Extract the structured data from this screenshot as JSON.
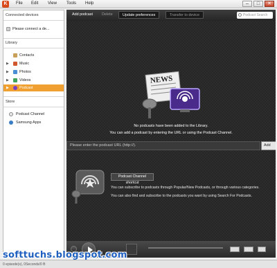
{
  "menubar": {
    "logo": "K",
    "items": [
      "File",
      "Edit",
      "View",
      "Tools",
      "Help"
    ]
  },
  "sidebar": {
    "connected_header": "Connected devices",
    "connect_prompt": "Please connect a de...",
    "library_header": "Library",
    "library_items": [
      {
        "label": "Contacts",
        "icon": "contacts-icon",
        "color": "#c9a058"
      },
      {
        "label": "Music",
        "icon": "music-icon",
        "color": "#d0582f"
      },
      {
        "label": "Photos",
        "icon": "photos-icon",
        "color": "#4a8fd6"
      },
      {
        "label": "Videos",
        "icon": "videos-icon",
        "color": "#3fa35a"
      },
      {
        "label": "Podcast",
        "icon": "podcast-icon",
        "color": "#7b3fc4"
      }
    ],
    "store_header": "Store",
    "store_items": [
      {
        "label": "Podcast Channel",
        "icon": "podcast-channel-icon"
      },
      {
        "label": "Samsung Apps",
        "icon": "samsung-apps-icon"
      }
    ],
    "selected_color": "#f0a030"
  },
  "toolbar": {
    "add_podcast": "Add podcast",
    "delete": "Delete",
    "update_preferences": "Update preferences",
    "transfer": "Transfer to device",
    "search_placeholder": "Podcast Search"
  },
  "content": {
    "empty_line1": "No podcasts have been added to the Library.",
    "empty_line2": "You can add a podcast by entering the URL or using the Podcast Channel.",
    "url_placeholder": "Please enter the podcast URL (http://).",
    "add_button": "Add",
    "news_text": "NEWS",
    "shortcut_button": "Podcast Channel shortcut",
    "info_line1": "You can subscribe to podcasts through Popular/New Podcasts, or through various categories.",
    "info_line2": "You can also find and subscribe to the podcasts you want by using Search For Podcasts."
  },
  "statusbar": {
    "text": "0 episode(s), 0Seconds/0 B"
  },
  "watermark": "softtuchs.blogspot.com"
}
